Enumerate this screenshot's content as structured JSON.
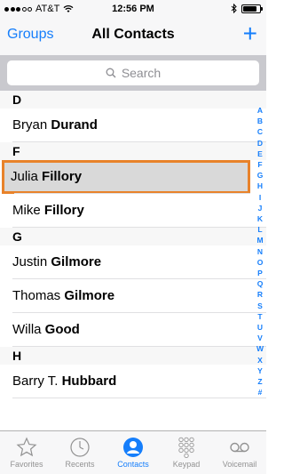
{
  "status": {
    "carrier": "AT&T",
    "time": "12:56 PM"
  },
  "nav": {
    "left": "Groups",
    "title": "All Contacts",
    "add": "+"
  },
  "search": {
    "placeholder": "Search"
  },
  "sections": [
    {
      "letter": "D",
      "contacts": [
        {
          "first": "Bryan",
          "last": "Durand"
        }
      ]
    },
    {
      "letter": "F",
      "contacts": [
        {
          "first": "Julia",
          "last": "Fillory",
          "selected": true
        },
        {
          "first": "Mike",
          "last": "Fillory"
        }
      ]
    },
    {
      "letter": "G",
      "contacts": [
        {
          "first": "Justin",
          "last": "Gilmore"
        },
        {
          "first": "Thomas",
          "last": "Gilmore"
        },
        {
          "first": "Willa",
          "last": "Good"
        }
      ]
    },
    {
      "letter": "H",
      "contacts": [
        {
          "first": "Barry T.",
          "last": "Hubbard"
        }
      ]
    }
  ],
  "index": [
    "A",
    "B",
    "C",
    "D",
    "E",
    "F",
    "G",
    "H",
    "I",
    "J",
    "K",
    "L",
    "M",
    "N",
    "O",
    "P",
    "Q",
    "R",
    "S",
    "T",
    "U",
    "V",
    "W",
    "X",
    "Y",
    "Z",
    "#"
  ],
  "tabs": [
    {
      "label": "Favorites",
      "icon": "star-icon"
    },
    {
      "label": "Recents",
      "icon": "clock-icon"
    },
    {
      "label": "Contacts",
      "icon": "person-icon",
      "active": true
    },
    {
      "label": "Keypad",
      "icon": "keypad-icon"
    },
    {
      "label": "Voicemail",
      "icon": "voicemail-icon"
    }
  ],
  "colors": {
    "accent": "#157efb",
    "highlight": "#e8822a"
  }
}
